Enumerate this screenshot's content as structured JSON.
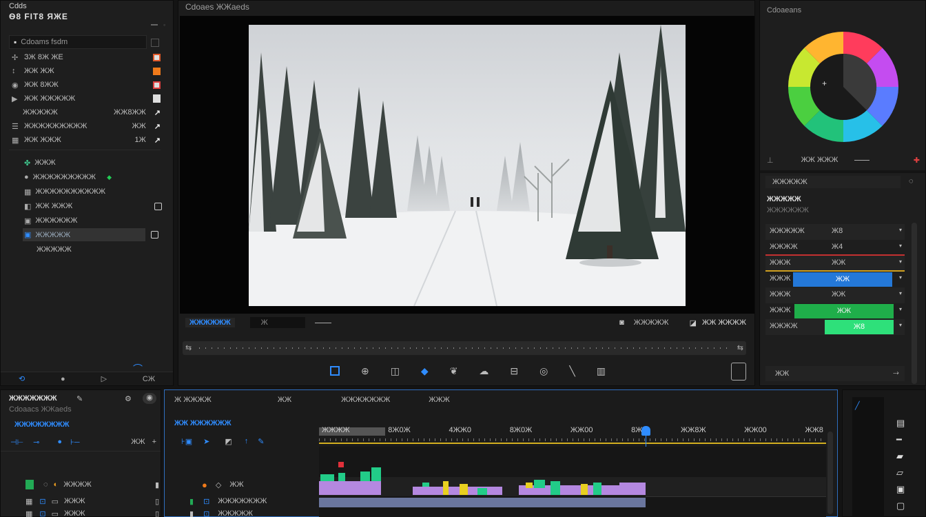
{
  "left_panel": {
    "title_line1": "Cdds",
    "title_line2": "Ѳ8 FIТ8 ЯЖЕ",
    "search_label": "Cdoams fsdm",
    "rows": [
      {
        "label": "ЗЖ 8Ж ЖЕ",
        "value": ""
      },
      {
        "label": "ЖЖ ЖЖ",
        "value": ""
      },
      {
        "label": "ЖЖ 8ЖЖ",
        "value": ""
      },
      {
        "label": "ЖЖ ЖЖЖЖЖ",
        "value": ""
      },
      {
        "label": "ЖЖЖЖЖ",
        "value": "ЖЖ8ЖЖ"
      },
      {
        "label": "ЖЖЖЖЖЖЖЖЖ",
        "value": "ЖЖ"
      },
      {
        "label": "ЖЖ ЖЖЖ",
        "value": "1Ж"
      }
    ],
    "sub_rows": [
      {
        "label": "ЖЖЖ"
      },
      {
        "label": "ЖЖЖЖЖЖЖЖЖ"
      },
      {
        "label": "ЖЖЖЖЖЖЖЖЖЖ"
      },
      {
        "label": "ЖЖ ЖЖЖ"
      },
      {
        "label": "ЖЖЖЖЖЖ"
      },
      {
        "label": "ЖЖЖЖЖ"
      },
      {
        "label": "ЖЖЖЖЖ"
      }
    ],
    "footer_label": "CЖ"
  },
  "viewer": {
    "title": "Cdoaes ЖЖaeds",
    "bottom_label": "ЖЖЖЖЖЖ",
    "small_field": "Ж",
    "right_label_1": "ЖЖЖЖЖ",
    "right_label_2": "ЖЖ ЖЖЖЖ"
  },
  "color_panel": {
    "title": "Cdoaeans",
    "row_label": "ЖЖ ЖЖЖ",
    "section_title": "ЖЖЖЖЖ",
    "sub_title": "ЖЖЖЖЖ",
    "sub_caption": "ЖЖЖЖЖЖ",
    "params": [
      {
        "label": "ЖЖЖЖЖ",
        "value": "Ж8"
      },
      {
        "label": "ЖЖЖЖ",
        "value": "Ж4"
      },
      {
        "label": "ЖЖЖ",
        "value": "ЖЖ"
      },
      {
        "label": "ЖЖЖ",
        "value": "ЖЖ"
      },
      {
        "label": "ЖЖЖ",
        "value": "ЖЖ"
      },
      {
        "label": "ЖЖЖ",
        "value": "ЖЖ"
      },
      {
        "label": "ЖЖЖЖ",
        "value": "Ж8"
      }
    ],
    "footer_label": "ЖЖ"
  },
  "timeline": {
    "left_title": "ЖЖЖЖЖЖЖ",
    "left_caption": "Cdoaacs ЖЖaeds",
    "left_blue_title": "ЖЖЖЖЖЖЖЖ",
    "left_count": "ЖЖ",
    "tab_labels": [
      "Ж ЖЖЖЖ",
      "ЖЖ",
      "ЖЖЖЖЖЖЖ",
      "ЖЖЖ"
    ],
    "blue_header": "ЖЖ ЖЖЖЖЖЖ",
    "ruler_marks": [
      "ЖЖЖЖ",
      "8Ж0Ж",
      "4ЖЖ0",
      "8Ж0Ж",
      "ЖЖ00",
      "8Ж",
      "ЖЖ8Ж",
      "ЖЖ00",
      "ЖЖ8"
    ],
    "track_labels": [
      "ЖЖ",
      "ЖЖЖЖЖЖЖ",
      "ЖЖЖЖЖ"
    ],
    "left_track_labels": [
      "ЖЖЖЖ",
      "ЖЖЖ",
      "ЖЖЖ"
    ]
  }
}
